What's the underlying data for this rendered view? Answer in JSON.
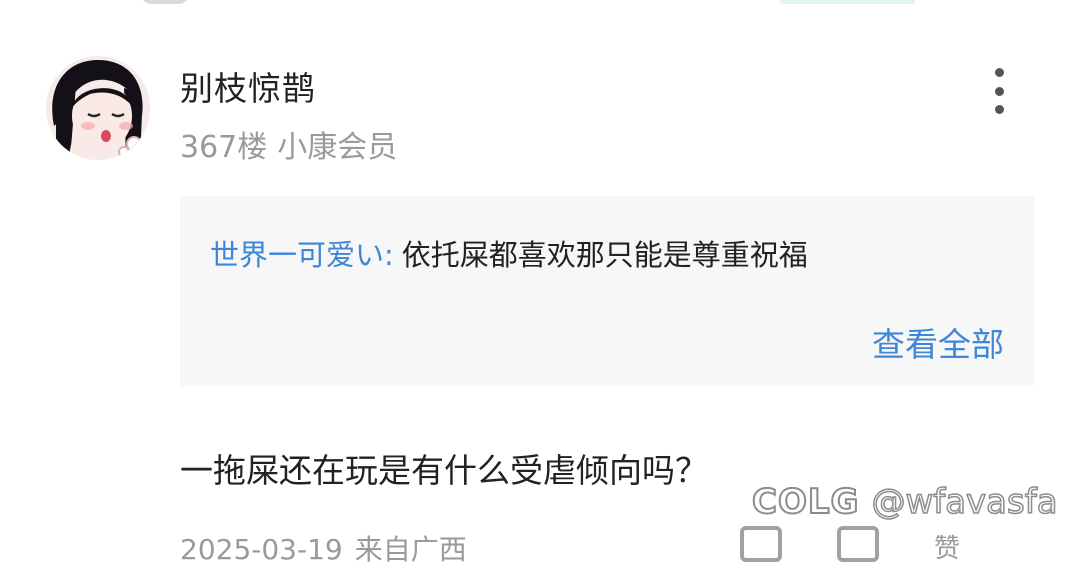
{
  "post": {
    "username": "别枝惊鹊",
    "floor": "367楼",
    "member_level": "小康会员",
    "avatar_icon": "anime-girl-avatar"
  },
  "quote": {
    "author": "世界一可爱い:",
    "text": "依托屎都喜欢那只能是尊重祝福",
    "view_all_label": "查看全部"
  },
  "comment": {
    "text": "一拖屎还在玩是有什么受虐倾向吗？"
  },
  "footer": {
    "date": "2025-03-19",
    "source": "来自广西",
    "like_label": "赞"
  },
  "watermark": {
    "logo": "COLG",
    "handle": "@wfavasfa"
  },
  "colors": {
    "link_blue": "#3f86d8",
    "quote_bg": "#f7f7f7",
    "meta_gray": "#9a9a9a"
  }
}
